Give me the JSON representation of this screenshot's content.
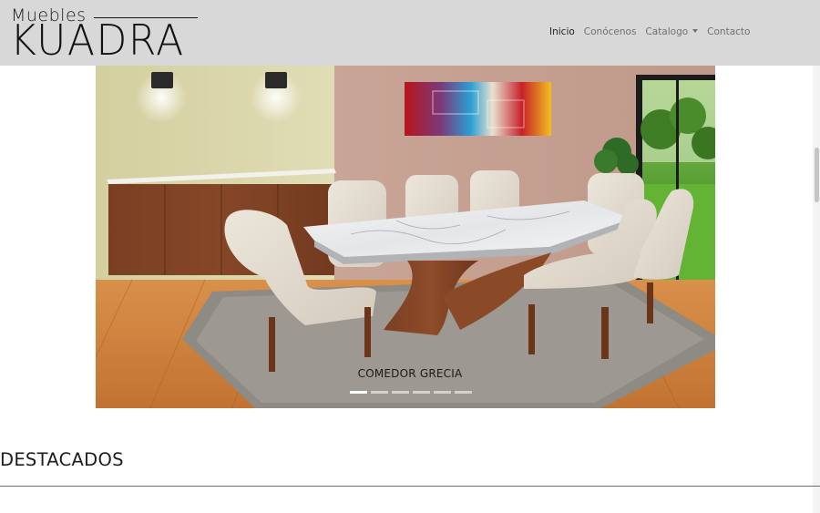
{
  "brand": {
    "top": "Muebles",
    "main": "KUADRA"
  },
  "nav": {
    "items": [
      {
        "label": "Inicio",
        "active": true
      },
      {
        "label": "Conócenos"
      },
      {
        "label": "Catalogo",
        "dropdown": true
      },
      {
        "label": "Contacto"
      }
    ]
  },
  "carousel": {
    "caption": "COMEDOR GRECIA",
    "slide_count": 6,
    "active_index": 0
  },
  "section": {
    "title": "DESTACADOS"
  },
  "colors": {
    "navbar_bg": "#d8d8d8",
    "nav_text": "#707070",
    "nav_active": "#222222"
  }
}
